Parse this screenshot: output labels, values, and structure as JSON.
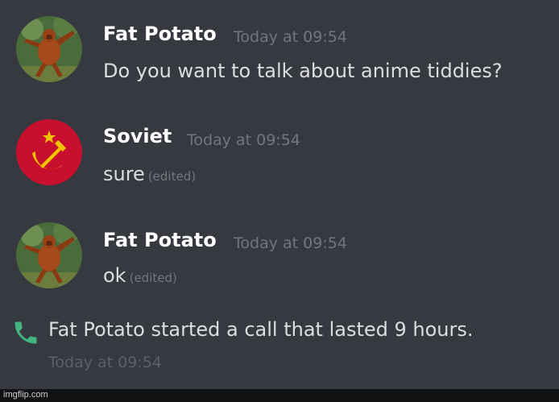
{
  "messages": [
    {
      "username": "Fat Potato",
      "timestamp": "Today at 09:54",
      "text": "Do you want to talk about anime tiddies?",
      "edited": "",
      "avatar": "orangutan-avatar"
    },
    {
      "username": "Soviet",
      "timestamp": "Today at 09:54",
      "text": "sure",
      "edited": "(edited)",
      "avatar": "hammer-sickle-avatar"
    },
    {
      "username": "Fat Potato",
      "timestamp": "Today at 09:54",
      "text": "ok",
      "edited": "(edited)",
      "avatar": "orangutan-avatar"
    }
  ],
  "call": {
    "icon": "phone-icon",
    "text": "Fat Potato started a call that lasted 9 hours.",
    "timestamp": "Today at 09:54"
  },
  "watermark": "imgflip.com",
  "colors": {
    "background": "#36393f",
    "username": "#ffffff",
    "message_text": "#dcddde",
    "timestamp": "#72767d",
    "call_icon": "#43b581",
    "soviet_red": "#c8102e",
    "soviet_gold": "#f2c200"
  }
}
